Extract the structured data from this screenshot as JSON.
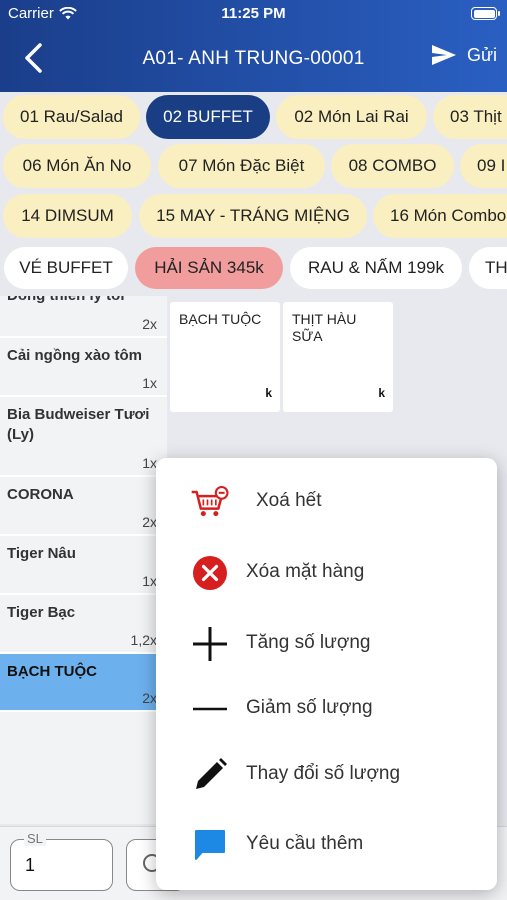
{
  "status": {
    "carrier": "Carrier",
    "time": "11:25 PM"
  },
  "nav": {
    "title": "A01- ANH TRUNG-00001",
    "send_label": "Gửi"
  },
  "categories": {
    "row1": [
      "01 Rau/Salad",
      "02 BUFFET",
      "02 Món Lai Rai",
      "03 Thịt"
    ],
    "row2": [
      "06 Món Ăn No",
      "07 Món Đặc Biệt",
      "08 COMBO",
      "09 I"
    ],
    "row3": [
      "14 DIMSUM",
      "15 MAY - TRÁNG MIỆNG",
      "16 Món Combo"
    ],
    "active": "02 BUFFET"
  },
  "subcategories": {
    "items": [
      "VÉ BUFFET",
      "HẢI SẢN 345k",
      "RAU & NẤM 199k",
      "TH"
    ],
    "active": "HẢI SẢN 345k"
  },
  "order_items": [
    {
      "name": "Đông thiên ly tỏi",
      "qty": "2x"
    },
    {
      "name": "Cải ngồng xào tôm",
      "qty": "1x"
    },
    {
      "name": "Bia Budweiser Tươi (Ly)",
      "qty": "1x"
    },
    {
      "name": "CORONA",
      "qty": "2x"
    },
    {
      "name": "Tiger Nâu",
      "qty": "1x"
    },
    {
      "name": "Tiger Bạc",
      "qty": "1,2x"
    },
    {
      "name": "BẠCH TUỘC",
      "qty": "2x",
      "selected": true
    }
  ],
  "products": [
    {
      "name": "BẠCH TUỘC",
      "price": "k"
    },
    {
      "name": "THỊT HÀU SỮA",
      "price": "k"
    }
  ],
  "bottom": {
    "sl_label": "SL",
    "qty_value": "1"
  },
  "menu": [
    {
      "label": "Xoá hết",
      "icon": "cart-remove-icon"
    },
    {
      "label": "Xóa mặt hàng",
      "icon": "delete-circle-icon"
    },
    {
      "label": "Tăng số lượng",
      "icon": "plus-icon"
    },
    {
      "label": "Giảm số lượng",
      "icon": "minus-icon"
    },
    {
      "label": "Thay đổi số lượng",
      "icon": "pencil-icon"
    },
    {
      "label": "Yêu cầu thêm",
      "icon": "message-icon"
    }
  ],
  "colors": {
    "header_start": "#1a3e8a",
    "header_end": "#2a5fc2",
    "chip_bg": "#f9efc0",
    "chip_active": "#1a3e83",
    "subchip_active": "#f19d9d",
    "selected_row": "#6cb0ee",
    "delete_red": "#d62020",
    "message_blue": "#1e88e5"
  }
}
